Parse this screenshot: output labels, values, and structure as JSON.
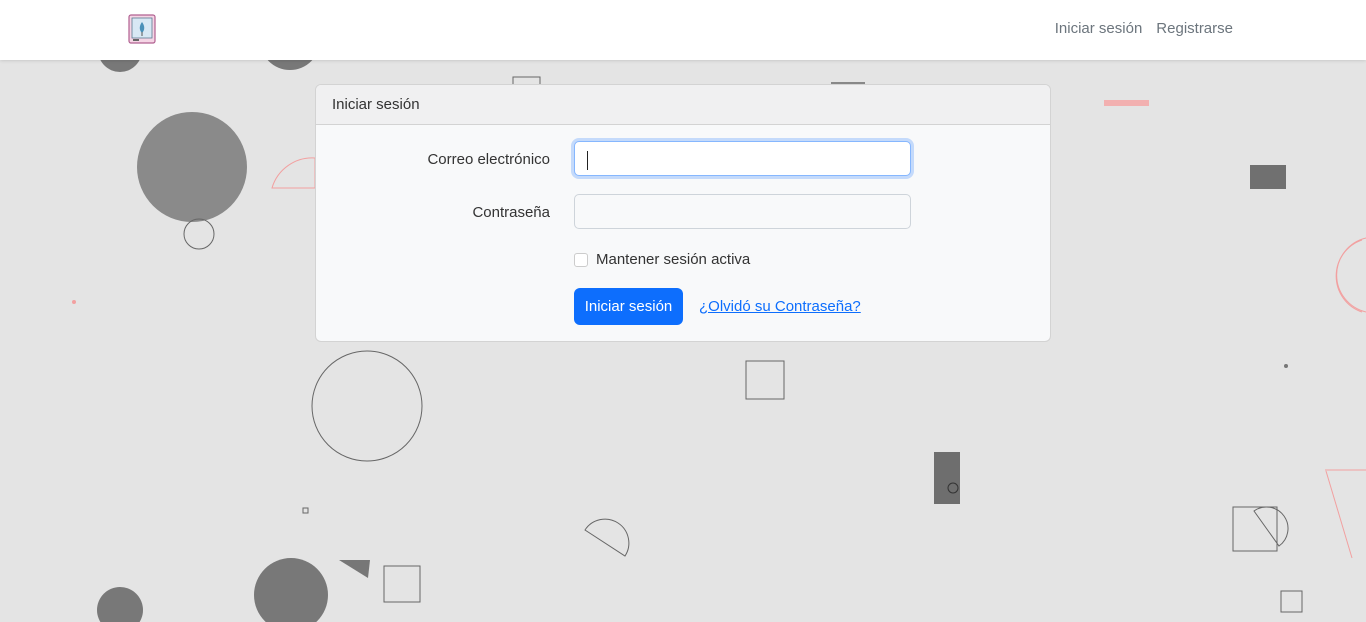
{
  "navbar": {
    "logo_icon": "picture-frame-logo-icon",
    "links": {
      "login": "Iniciar sesión",
      "register": "Registrarse"
    }
  },
  "login_card": {
    "header": "Iniciar sesión",
    "email_label": "Correo electrónico",
    "email_value": "",
    "password_label": "Contraseña",
    "password_value": "",
    "remember_label": "Mantener sesión activa",
    "remember_checked": false,
    "submit_label": "Iniciar sesión",
    "forgot_link": "¿Olvidó su Contraseña?"
  },
  "colors": {
    "primary": "#0d6efd",
    "background": "#e4e4e4",
    "shape_fill": "#888888",
    "accent_pink": "#f2a0a0"
  }
}
